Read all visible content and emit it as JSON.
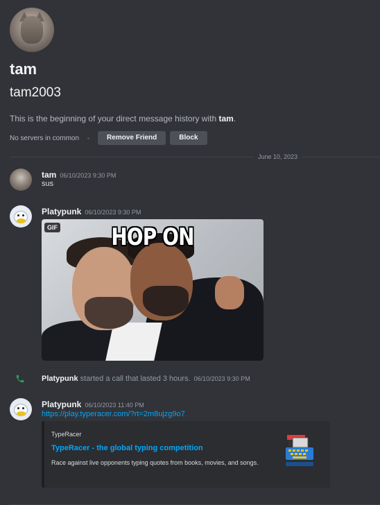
{
  "profile": {
    "display_name": "tam",
    "username": "tam2003",
    "intro_prefix": "This is the beginning of your direct message history with ",
    "intro_name": "tam",
    "intro_suffix": ".",
    "common": "No servers in common",
    "remove_friend": "Remove Friend",
    "block": "Block"
  },
  "divider": {
    "date": "June 10, 2023"
  },
  "messages": [
    {
      "author": "tam",
      "timestamp": "06/10/2023 9:30 PM",
      "text": "sus",
      "avatar_icon": "cat-avatar"
    },
    {
      "author": "Platypunk",
      "timestamp": "06/10/2023 9:30 PM",
      "avatar_icon": "platypus-avatar",
      "gif": {
        "badge": "GIF",
        "caption": "HOP ON"
      }
    },
    {
      "type": "call",
      "author": "Platypunk",
      "text": " started a call that lasted 3 hours.",
      "timestamp": "06/10/2023 9:30 PM",
      "icon": "phone-icon"
    },
    {
      "author": "Platypunk",
      "timestamp": "06/10/2023 11:40 PM",
      "avatar_icon": "platypus-avatar",
      "link": "https://play.typeracer.com/?rt=2m8ujzg9o7",
      "embed": {
        "provider": "TypeRacer",
        "title": "TypeRacer - the global typing competition",
        "description": "Race against live opponents typing quotes from books, movies, and songs."
      }
    }
  ],
  "colors": {
    "background": "#313338",
    "link": "#00a8fc",
    "button": "#4e5058",
    "call_icon": "#23a55a"
  }
}
